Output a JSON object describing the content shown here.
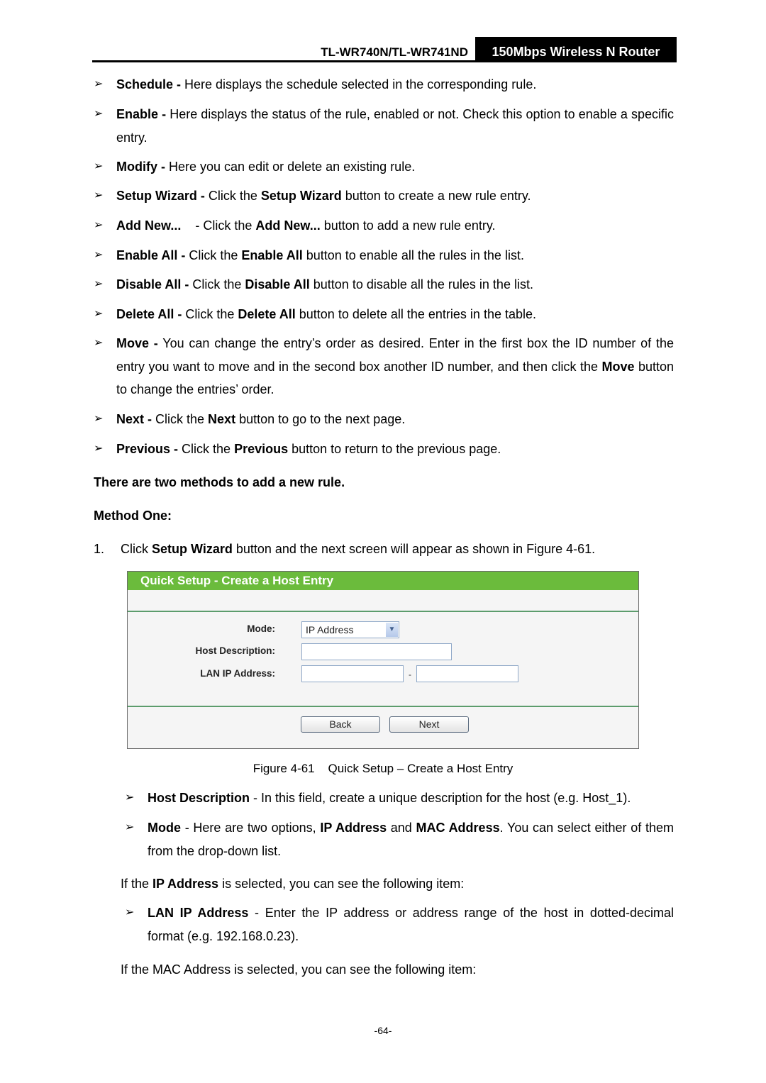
{
  "header": {
    "model": "TL-WR740N/TL-WR741ND",
    "product": "150Mbps Wireless N Router"
  },
  "bullets": [
    {
      "term": "Schedule -",
      "text": " Here displays the schedule selected in the corresponding rule."
    },
    {
      "term": "Enable -",
      "text": " Here displays the status of the rule, enabled or not. Check this option to enable a specific entry."
    },
    {
      "term": "Modify -",
      "text": " Here you can edit or delete an existing rule."
    },
    {
      "term": "Setup Wizard -",
      "pre": " Click the ",
      "bold2": "Setup Wizard",
      "post": " button to create a new rule entry."
    },
    {
      "term": "Add New...",
      "pre": "    - Click the ",
      "bold2": "Add New...",
      "post": " button to add a new rule entry."
    },
    {
      "term": "Enable All -",
      "pre": " Click the ",
      "bold2": "Enable All",
      "post": " button to enable all the rules in the list."
    },
    {
      "term": "Disable All -",
      "pre": " Click the ",
      "bold2": "Disable All",
      "post": " button to disable all the rules in the list."
    },
    {
      "term": "Delete All -",
      "pre": " Click the ",
      "bold2": "Delete All",
      "post": " button to delete all the entries in the table."
    },
    {
      "term": "Move -",
      "pre": " You can change the entry’s order as desired. Enter in the first box the ID number of the entry you want to move and in the second box another ID number, and then click the ",
      "bold2": "Move",
      "post": " button to change the entries’ order."
    },
    {
      "term": "Next -",
      "pre": " Click the ",
      "bold2": "Next",
      "post": " button to go to the next page."
    },
    {
      "term": "Previous -",
      "pre": " Click the ",
      "bold2": "Previous",
      "post": " button to return to the previous page."
    }
  ],
  "headings": {
    "methods": "There are two methods to add a new rule.",
    "method_one": "Method One:"
  },
  "step1": {
    "num": "1.",
    "pre": "Click ",
    "bold": "Setup Wizard",
    "post": " button and the next screen will appear as shown in Figure 4-61."
  },
  "figure": {
    "title": "Quick Setup - Create a Host Entry",
    "mode_label": "Mode:",
    "mode_value": "IP Address",
    "host_desc_label": "Host Description:",
    "host_desc_value": "",
    "lan_ip_label": "LAN IP Address:",
    "lan_ip_start": "",
    "lan_ip_end": "",
    "range_sep": "-",
    "back_label": "Back",
    "next_label": "Next",
    "caption": "Figure 4-61    Quick Setup – Create a Host Entry"
  },
  "bullets2": [
    {
      "term": "Host Description",
      "text": " - In this field, create a unique description for the host (e.g. Host_1)."
    },
    {
      "term": "Mode",
      "pre": " - Here are two options, ",
      "bold2": "IP Address",
      "mid": " and ",
      "bold3": "MAC Address",
      "post": ". You can select either of them from the drop-down list."
    }
  ],
  "para_ip": {
    "pre": "If the ",
    "bold": "IP Address",
    "post": " is selected, you can see the following item:"
  },
  "bullet_lan": {
    "term": "LAN IP Address",
    "text": " - Enter the IP address or address range of the host in dotted-decimal format (e.g. 192.168.0.23)."
  },
  "para_mac": "If the MAC Address is selected, you can see the following item:",
  "page_number": "-64-",
  "icons": {
    "bullet": "➢",
    "dropdown": "▼"
  }
}
